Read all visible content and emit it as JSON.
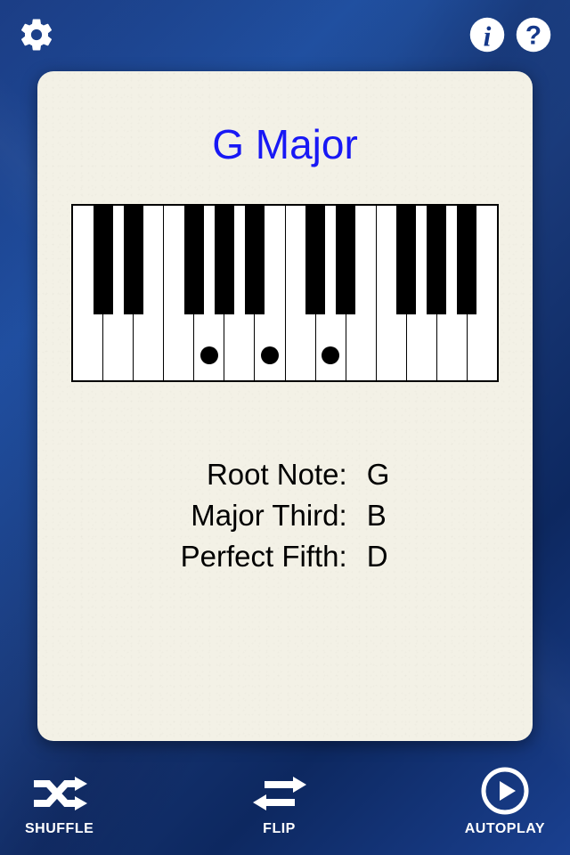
{
  "chord": {
    "title": "G Major",
    "root_label": "Root Note:",
    "root_value": "G",
    "third_label": "Major Third:",
    "third_value": "B",
    "fifth_label": "Perfect Fifth:",
    "fifth_value": "D"
  },
  "toolbar": {
    "shuffle_label": "SHUFFLE",
    "flip_label": "FLIP",
    "autoplay_label": "AUTOPLAY"
  },
  "icons": {
    "settings": "gear-icon",
    "info": "info-icon",
    "help": "help-icon",
    "shuffle": "shuffle-icon",
    "flip": "flip-icon",
    "autoplay": "play-circle-icon"
  }
}
